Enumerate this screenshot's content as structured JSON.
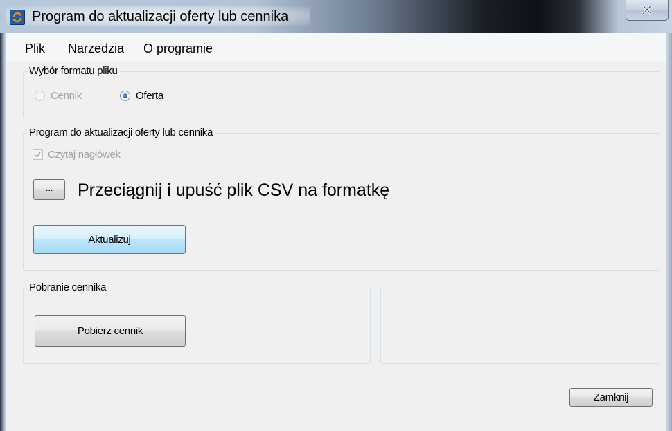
{
  "window": {
    "title": "Program do aktualizacji oferty lub cennika"
  },
  "menu": {
    "items": [
      "Plik",
      "Narzedzia",
      "O programie"
    ]
  },
  "format_group": {
    "legend": "Wybór formatu pliku",
    "options": [
      {
        "label": "Cennik",
        "selected": false,
        "enabled": false
      },
      {
        "label": "Oferta",
        "selected": true,
        "enabled": true
      }
    ]
  },
  "update_group": {
    "legend": "Program do aktualizacji oferty lub cennika",
    "read_header_label": "Czytaj nagłówek",
    "read_header_checked": true,
    "read_header_enabled": false,
    "browse_label": "...",
    "drop_hint": "Przeciągnij i upuść plik CSV na formatkę",
    "update_button": "Aktualizuj"
  },
  "download_group": {
    "legend": "Pobranie cennika",
    "download_button": "Pobierz cennik"
  },
  "footer": {
    "close_button": "Zamknij"
  },
  "icons": {
    "app": "app-refresh-icon",
    "close": "close-icon"
  }
}
